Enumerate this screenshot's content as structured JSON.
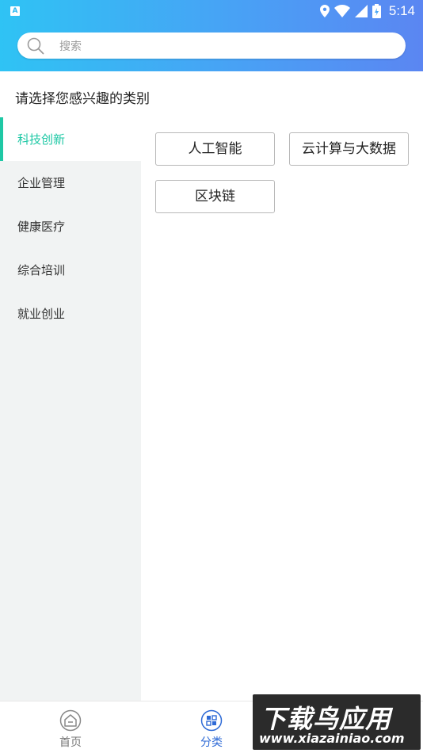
{
  "status_bar": {
    "app_badge": "A",
    "time": "5:14"
  },
  "search": {
    "placeholder": "搜索"
  },
  "prompt": "请选择您感兴趣的类别",
  "sidebar": {
    "items": [
      {
        "label": "科技创新",
        "active": true
      },
      {
        "label": "企业管理",
        "active": false
      },
      {
        "label": "健康医疗",
        "active": false
      },
      {
        "label": "综合培训",
        "active": false
      },
      {
        "label": "就业创业",
        "active": false
      }
    ]
  },
  "tags": [
    {
      "label": "人工智能"
    },
    {
      "label": "云计算与大数据"
    },
    {
      "label": "区块链"
    }
  ],
  "bottom_nav": {
    "items": [
      {
        "label": "首页",
        "icon": "home-icon",
        "active": false
      },
      {
        "label": "分类",
        "icon": "category-icon",
        "active": true
      }
    ]
  },
  "watermark": {
    "title": "下载鸟应用",
    "url": "www.xiazainiao.com"
  },
  "colors": {
    "accent": "#1ec8a5",
    "nav_active": "#2e6ad6",
    "header_start": "#2fc3f4",
    "header_end": "#5b86f2"
  }
}
